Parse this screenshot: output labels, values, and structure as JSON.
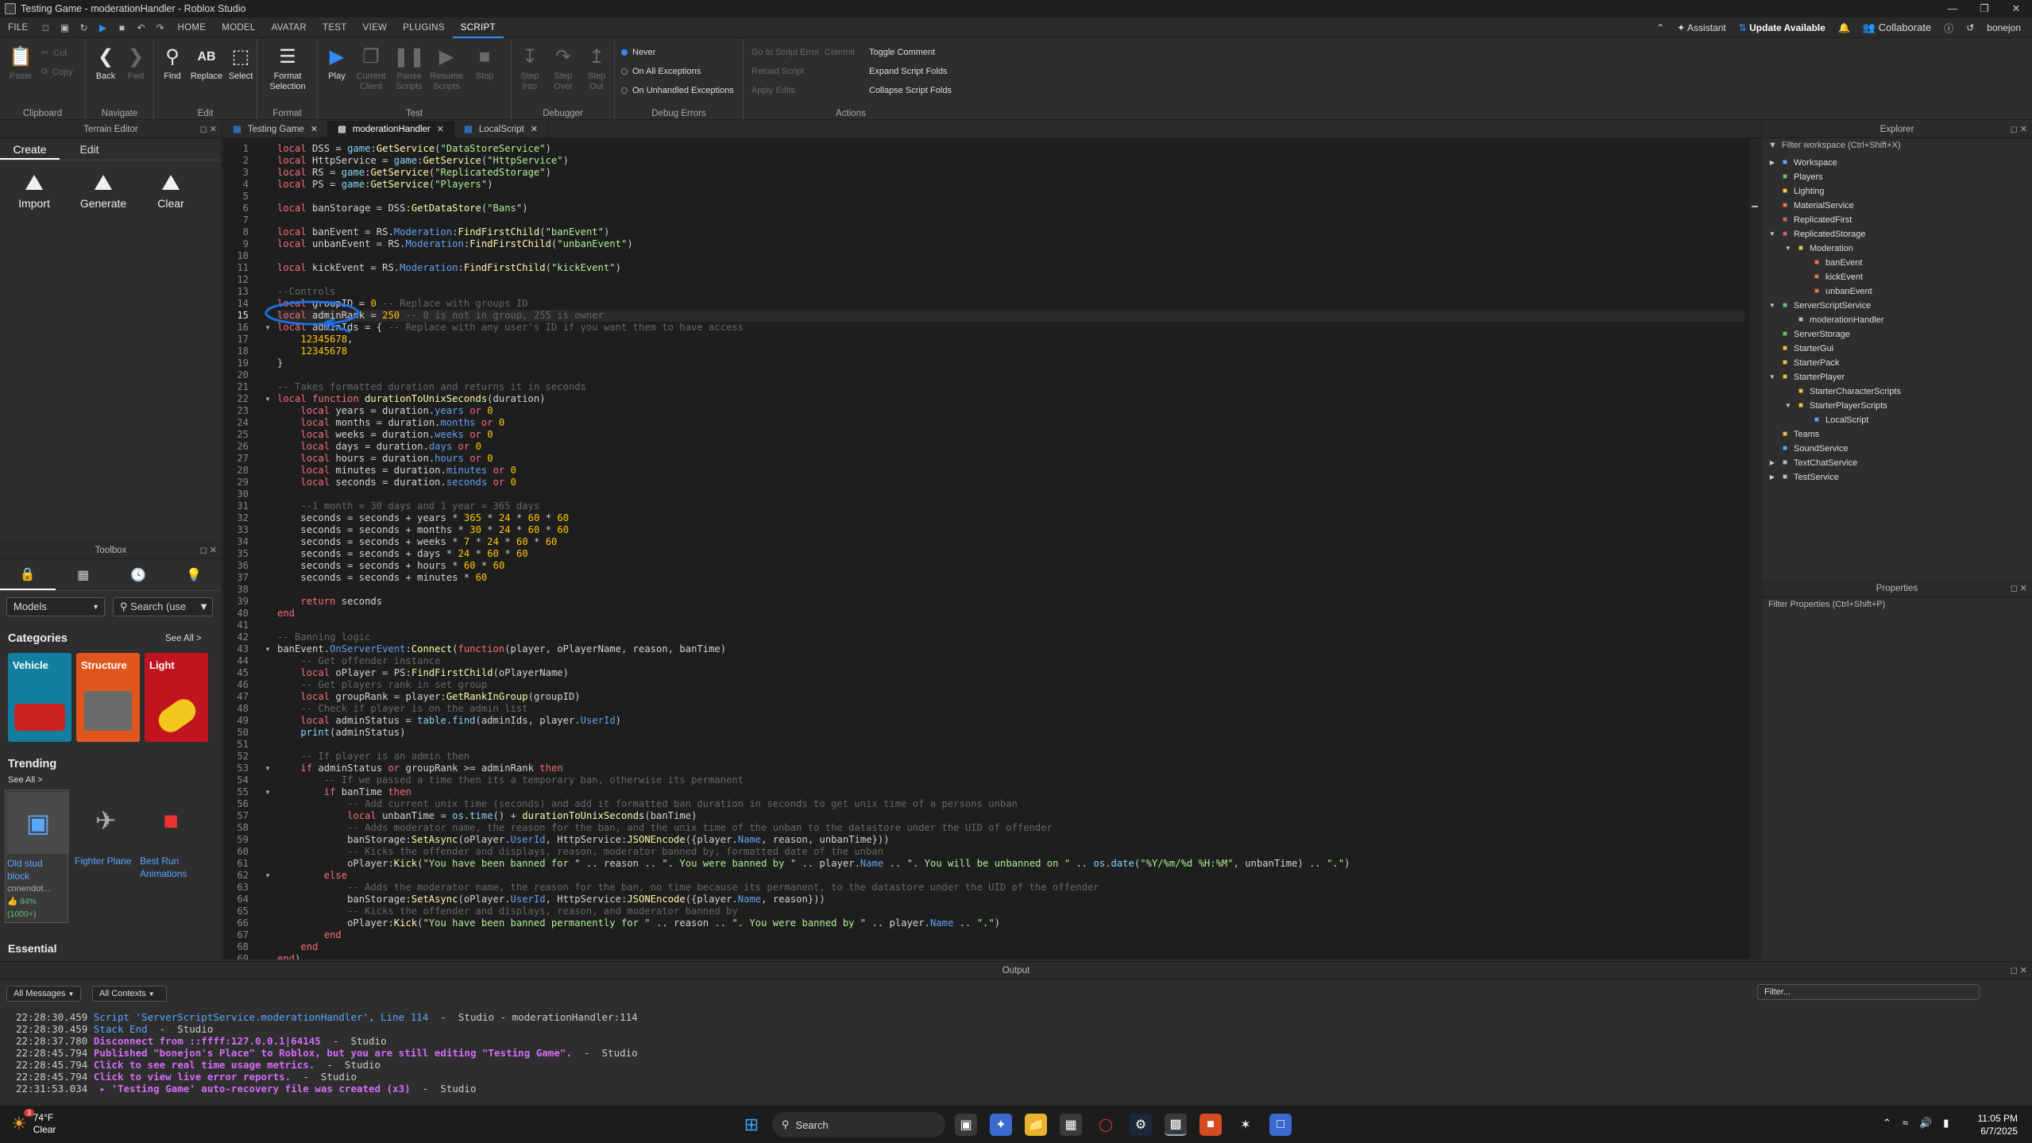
{
  "window": {
    "title": "Testing Game - moderationHandler - Roblox Studio"
  },
  "menu": {
    "items": [
      "FILE",
      "HOME",
      "MODEL",
      "AVATAR",
      "TEST",
      "VIEW",
      "PLUGINS",
      "SCRIPT"
    ],
    "active": "SCRIPT",
    "assistant": "Assistant",
    "update": "Update Available",
    "collaborate": "Collaborate",
    "user": "bonejon"
  },
  "ribbon": {
    "clipboard": {
      "label": "Clipboard",
      "paste": "Paste",
      "cut": "Cut",
      "copy": "Copy"
    },
    "navigate": {
      "label": "Navigate",
      "back": "Back",
      "fwd": "Fwd"
    },
    "edit": {
      "label": "Edit",
      "find": "Find",
      "replace": "Replace",
      "select": "Select"
    },
    "format": {
      "label": "Format",
      "format_selection": "Format Selection"
    },
    "test": {
      "label": "Test",
      "play": "Play",
      "current_client": "Current Client",
      "pause_scripts": "Pause Scripts",
      "resume_scripts": "Resume Scripts",
      "stop": "Stop"
    },
    "debugger": {
      "label": "Debugger",
      "step_into": "Step Into",
      "step_over": "Step Over",
      "step_out": "Step Out"
    },
    "debug_errors": {
      "label": "Debug Errors",
      "never": "Never",
      "all": "On All Exceptions",
      "unhandled": "On Unhandled Exceptions"
    },
    "actions": {
      "label": "Actions",
      "go_to_error": "Go to Script Error",
      "commit": "Commit",
      "reload": "Reload Script",
      "apply_edits": "Apply Edits",
      "toggle_comment": "Toggle Comment",
      "expand": "Expand Script Folds",
      "collapse": "Collapse Script Folds"
    }
  },
  "terrain": {
    "title": "Terrain Editor",
    "tabs": [
      "Create",
      "Edit"
    ],
    "buttons": [
      "Import",
      "Generate",
      "Clear"
    ]
  },
  "toolbox": {
    "title": "Toolbox",
    "models": "Models",
    "search_placeholder": "Search (use",
    "categories_title": "Categories",
    "see_all": "See All >",
    "categories": [
      {
        "name": "Vehicle",
        "color": "#127fa1"
      },
      {
        "name": "Structure",
        "color": "#e0561c"
      },
      {
        "name": "Light",
        "color": "#c2141e"
      }
    ],
    "trending_title": "Trending",
    "trending_see_all": "See All >",
    "trending": [
      {
        "name": "Old stud block",
        "creator": "cnnendot...",
        "rating": "94% (1000+)"
      },
      {
        "name": "Fighter Plane"
      },
      {
        "name": "Best Run Animations"
      }
    ],
    "essential": "Essential"
  },
  "tabs": [
    {
      "label": "Testing Game"
    },
    {
      "label": "moderationHandler",
      "active": true
    },
    {
      "label": "LocalScript"
    }
  ],
  "code_lines": [
    "local DSS = game:GetService(\"DataStoreService\")",
    "local HttpService = game:GetService(\"HttpService\")",
    "local RS = game:GetService(\"ReplicatedStorage\")",
    "local PS = game:GetService(\"Players\")",
    "",
    "local banStorage = DSS:GetDataStore(\"Bans\")",
    "",
    "local banEvent = RS.Moderation:FindFirstChild(\"banEvent\")",
    "local unbanEvent = RS.Moderation:FindFirstChild(\"unbanEvent\")",
    "",
    "local kickEvent = RS.Moderation:FindFirstChild(\"kickEvent\")",
    "",
    "--Controls",
    "local groupID = 0 -- Replace with groups ID",
    "local adminRank = 250 -- 0 is not in group, 255 is owner",
    "local adminIds = { -- Replace with any user's ID if you want them to have access",
    "    12345678,",
    "    12345678",
    "}",
    "",
    "-- Takes formatted duration and returns it in seconds",
    "local function durationToUnixSeconds(duration)",
    "    local years = duration.years or 0",
    "    local months = duration.months or 0",
    "    local weeks = duration.weeks or 0",
    "    local days = duration.days or 0",
    "    local hours = duration.hours or 0",
    "    local minutes = duration.minutes or 0",
    "    local seconds = duration.seconds or 0",
    "",
    "    --1 month = 30 days and 1 year = 365 days",
    "    seconds = seconds + years * 365 * 24 * 60 * 60",
    "    seconds = seconds + months * 30 * 24 * 60 * 60",
    "    seconds = seconds + weeks * 7 * 24 * 60 * 60",
    "    seconds = seconds + days * 24 * 60 * 60",
    "    seconds = seconds + hours * 60 * 60",
    "    seconds = seconds + minutes * 60",
    "",
    "    return seconds",
    "end",
    "",
    "-- Banning logic",
    "banEvent.OnServerEvent:Connect(function(player, oPlayerName, reason, banTime)",
    "    -- Get offender instance",
    "    local oPlayer = PS:FindFirstChild(oPlayerName)",
    "    -- Get players rank in set group",
    "    local groupRank = player:GetRankInGroup(groupID)",
    "    -- Check if player is on the admin list",
    "    local adminStatus = table.find(adminIds, player.UserId)",
    "    print(adminStatus)",
    "",
    "    -- If player is an admin then",
    "    if adminStatus or groupRank >= adminRank then",
    "        -- If we passed a time then its a temporary ban, otherwise its permanent",
    "        if banTime then",
    "            -- Add current unix time (seconds) and add it formatted ban duration in seconds to get unix time of a persons unban",
    "            local unbanTime = os.time() + durationToUnixSeconds(banTime)",
    "            -- Adds moderator name, the reason for the ban, and the unix time of the unban to the datastore under the UID of offender",
    "            banStorage:SetAsync(oPlayer.UserId, HttpService:JSONEncode({player.Name, reason, unbanTime}))",
    "            -- Kicks the offender and displays, reason, moderator banned by, formatted date of the unban",
    "            oPlayer:Kick(\"You have been banned for \" .. reason .. \". You were banned by \" .. player.Name .. \". You will be unbanned on \" .. os.date(\"%Y/%m/%d %H:%M\", unbanTime) .. \".\")",
    "        else",
    "            -- Adds the moderator name, the reason for the ban, no time because its permanent, to the datastore under the UID of the offender",
    "            banStorage:SetAsync(oPlayer.UserId, HttpService:JSONEncode({player.Name, reason}))",
    "            -- Kicks the offender and displays, reason, and moderator banned by",
    "            oPlayer:Kick(\"You have been banned permanently for \" .. reason .. \". You were banned by \" .. player.Name .. \".\")",
    "        end",
    "    end",
    "end)"
  ],
  "current_line": 15,
  "explorer": {
    "title": "Explorer",
    "filter": "Filter workspace (Ctrl+Shift+X)",
    "items": [
      {
        "name": "Workspace",
        "depth": 0,
        "arrow": "right",
        "icon": "workspace-icon",
        "color": "#5aa7ff"
      },
      {
        "name": "Players",
        "depth": 0,
        "arrow": "",
        "icon": "players-icon",
        "color": "#6cc070"
      },
      {
        "name": "Lighting",
        "depth": 0,
        "arrow": "",
        "icon": "lighting-icon",
        "color": "#f5d042"
      },
      {
        "name": "MaterialService",
        "depth": 0,
        "arrow": "",
        "icon": "material-icon",
        "color": "#e8773a"
      },
      {
        "name": "ReplicatedFirst",
        "depth": 0,
        "arrow": "",
        "icon": "replicated-first-icon",
        "color": "#d95d5d"
      },
      {
        "name": "ReplicatedStorage",
        "depth": 0,
        "arrow": "down",
        "icon": "replicated-storage-icon",
        "color": "#d95d5d"
      },
      {
        "name": "Moderation",
        "depth": 1,
        "arrow": "down",
        "icon": "folder-icon",
        "color": "#e8c547"
      },
      {
        "name": "banEvent",
        "depth": 2,
        "arrow": "",
        "icon": "remote-event-icon",
        "color": "#e8773a"
      },
      {
        "name": "kickEvent",
        "depth": 2,
        "arrow": "",
        "icon": "remote-event-icon",
        "color": "#e8773a"
      },
      {
        "name": "unbanEvent",
        "depth": 2,
        "arrow": "",
        "icon": "remote-event-icon",
        "color": "#e8773a"
      },
      {
        "name": "ServerScriptService",
        "depth": 0,
        "arrow": "down",
        "icon": "server-script-service-icon",
        "color": "#6cc070"
      },
      {
        "name": "moderationHandler",
        "depth": 1,
        "arrow": "",
        "icon": "script-icon",
        "color": "#bbbbbb"
      },
      {
        "name": "ServerStorage",
        "depth": 0,
        "arrow": "",
        "icon": "server-storage-icon",
        "color": "#6cc070"
      },
      {
        "name": "StarterGui",
        "depth": 0,
        "arrow": "",
        "icon": "starter-gui-icon",
        "color": "#e8c547"
      },
      {
        "name": "StarterPack",
        "depth": 0,
        "arrow": "",
        "icon": "starter-pack-icon",
        "color": "#e8c547"
      },
      {
        "name": "StarterPlayer",
        "depth": 0,
        "arrow": "down",
        "icon": "starter-player-icon",
        "color": "#e8c547"
      },
      {
        "name": "StarterCharacterScripts",
        "depth": 1,
        "arrow": "",
        "icon": "folder-icon",
        "color": "#e8c547"
      },
      {
        "name": "StarterPlayerScripts",
        "depth": 1,
        "arrow": "down",
        "icon": "folder-icon",
        "color": "#e8c547"
      },
      {
        "name": "LocalScript",
        "depth": 2,
        "arrow": "",
        "icon": "local-script-icon",
        "color": "#5aa7ff"
      },
      {
        "name": "Teams",
        "depth": 0,
        "arrow": "",
        "icon": "teams-icon",
        "color": "#e8c547"
      },
      {
        "name": "SoundService",
        "depth": 0,
        "arrow": "",
        "icon": "sound-service-icon",
        "color": "#5aa7ff"
      },
      {
        "name": "TextChatService",
        "depth": 0,
        "arrow": "right",
        "icon": "text-chat-icon",
        "color": "#bbbbbb"
      },
      {
        "name": "TestService",
        "depth": 0,
        "arrow": "right",
        "icon": "test-service-icon",
        "color": "#bbbbbb"
      }
    ]
  },
  "properties": {
    "title": "Properties",
    "filter": "Filter Properties (Ctrl+Shift+P)"
  },
  "output": {
    "title": "Output",
    "messages_filter": "All Messages",
    "contexts_filter": "All Contexts",
    "filter_placeholder": "Filter...",
    "lines": [
      {
        "time": "22:28:30.459",
        "text": "Script 'ServerScriptService.moderationHandler', Line 114",
        "suffix": "  -  Studio - moderationHandler:114",
        "color": "#5aa7ff",
        "bold": false
      },
      {
        "time": "22:28:30.459",
        "text": "Stack End",
        "suffix": "  -  Studio",
        "color": "#5aa7ff",
        "bold": false
      },
      {
        "time": "22:28:37.780",
        "text": "Disconnect from ::ffff:127.0.0.1|64145",
        "suffix": "  -  Studio",
        "color": "#d66cf7",
        "bold": true
      },
      {
        "time": "22:28:45.794",
        "text": "Published \"bonejon's Place\" to Roblox, but you are still editing \"Testing Game\".",
        "suffix": "  -  Studio",
        "color": "#d66cf7",
        "bold": true
      },
      {
        "time": "22:28:45.794",
        "text": "Click to see real time usage metrics.",
        "suffix": "  -  Studio",
        "color": "#d66cf7",
        "bold": true
      },
      {
        "time": "22:28:45.794",
        "text": "Click to view live error reports.",
        "suffix": "  -  Studio",
        "color": "#d66cf7",
        "bold": true
      },
      {
        "time": "22:31:53.034",
        "text": " ▸ 'Testing Game' auto-recovery file was created (x3)",
        "suffix": "  -  Studio",
        "color": "#d66cf7",
        "bold": true
      }
    ]
  },
  "taskbar": {
    "weather_temp": "74°F",
    "weather_desc": "Clear",
    "weather_badge": "3",
    "search": "Search",
    "time": "11:05 PM",
    "date": "6/7/2025"
  }
}
